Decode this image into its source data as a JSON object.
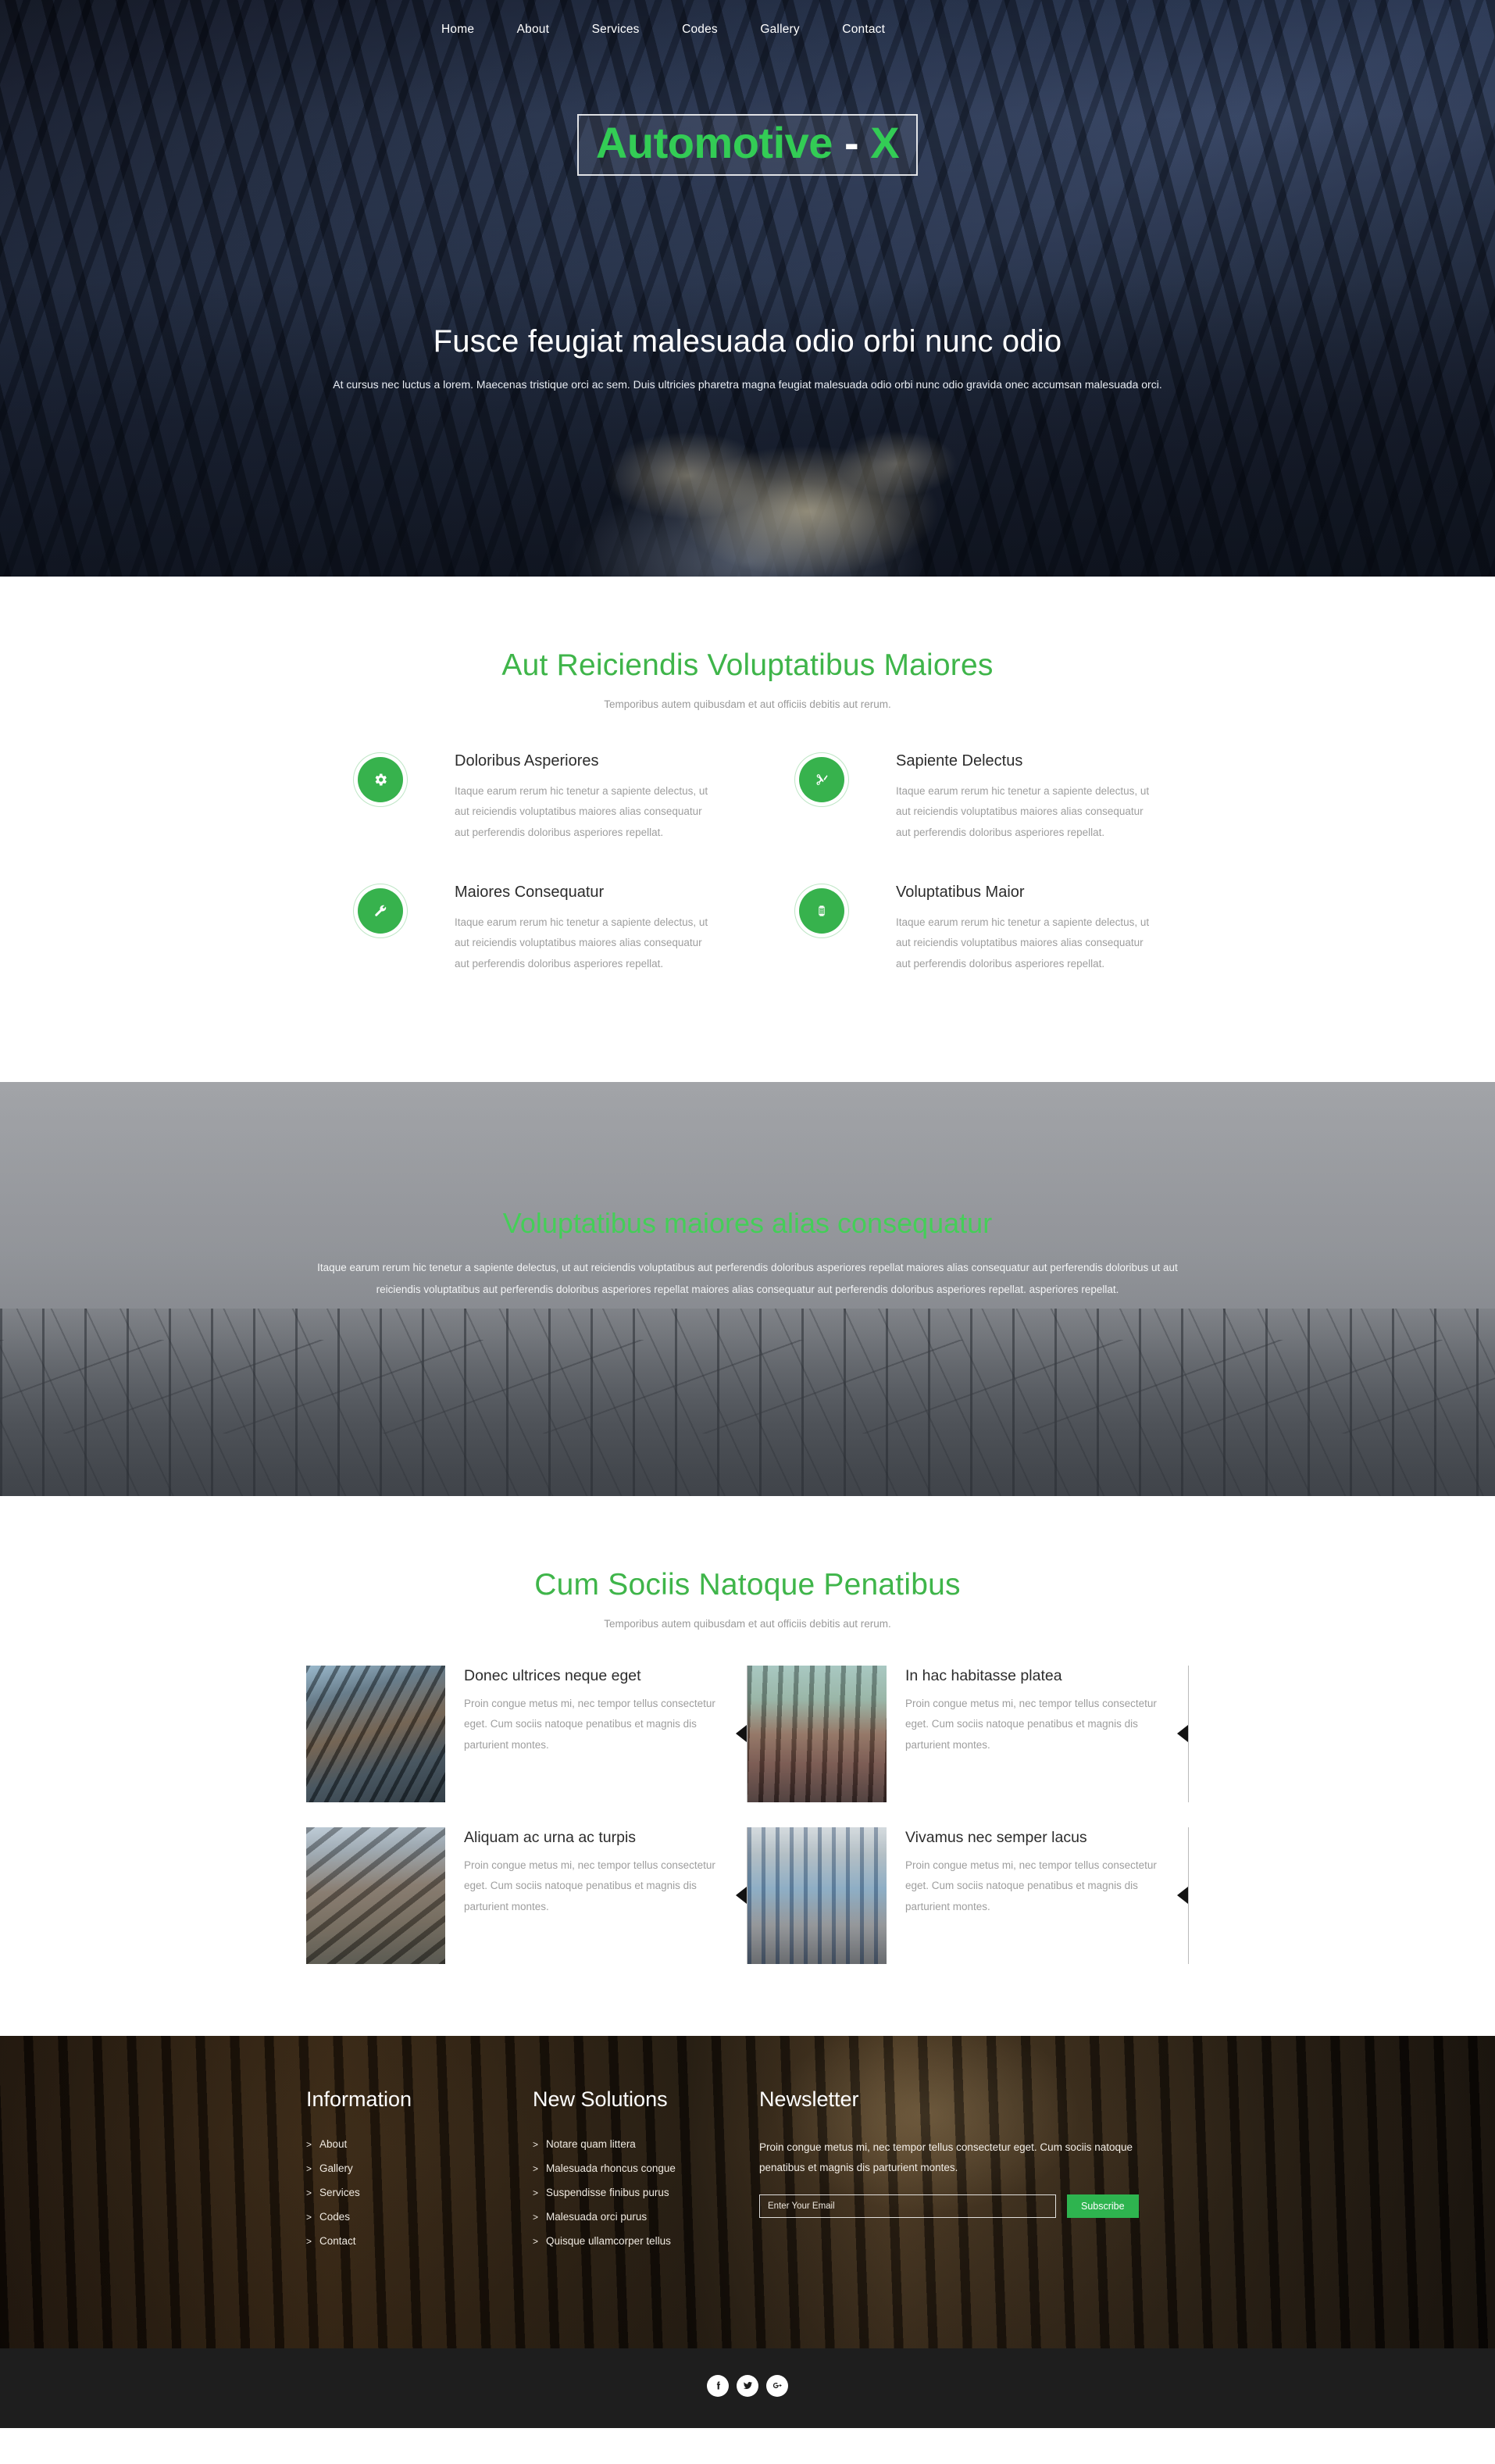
{
  "nav": {
    "items": [
      {
        "label": "Home"
      },
      {
        "label": "About"
      },
      {
        "label": "Services"
      },
      {
        "label": "Codes"
      },
      {
        "label": "Gallery"
      },
      {
        "label": "Contact"
      }
    ]
  },
  "hero": {
    "logo_main": "Automotive",
    "logo_dash": "-",
    "logo_suffix": "X",
    "title": "Fusce feugiat malesuada odio orbi nunc odio",
    "subtitle": "At cursus nec luctus a lorem. Maecenas tristique orci ac sem. Duis ultricies pharetra magna feugiat malesuada odio orbi nunc odio gravida onec accumsan malesuada orci."
  },
  "services": {
    "title": "Aut Reiciendis Voluptatibus Maiores",
    "subtitle": "Temporibus autem quibusdam et aut officiis debitis aut rerum.",
    "items": [
      {
        "icon": "gear-icon",
        "title": "Doloribus Asperiores",
        "text": "Itaque earum rerum hic tenetur a sapiente delectus, ut aut reiciendis voluptatibus maiores alias consequatur aut perferendis doloribus asperiores repellat."
      },
      {
        "icon": "scissors-icon",
        "title": "Sapiente Delectus",
        "text": "Itaque earum rerum hic tenetur a sapiente delectus, ut aut reiciendis voluptatibus maiores alias consequatur aut perferendis doloribus asperiores repellat."
      },
      {
        "icon": "wrench-icon",
        "title": "Maiores Consequatur",
        "text": "Itaque earum rerum hic tenetur a sapiente delectus, ut aut reiciendis voluptatibus maiores alias consequatur aut perferendis doloribus asperiores repellat."
      },
      {
        "icon": "battery-icon",
        "title": "Voluptatibus Maior",
        "text": "Itaque earum rerum hic tenetur a sapiente delectus, ut aut reiciendis voluptatibus maiores alias consequatur aut perferendis doloribus asperiores repellat."
      }
    ]
  },
  "parallax": {
    "title": "Voluptatibus maiores alias consequatur",
    "text": "Itaque earum rerum hic tenetur a sapiente delectus, ut aut reiciendis voluptatibus aut perferendis doloribus asperiores repellat maiores alias consequatur aut perferendis doloribus ut aut reiciendis voluptatibus aut perferendis doloribus asperiores repellat maiores alias consequatur aut perferendis doloribus asperiores repellat. asperiores repellat."
  },
  "gallery": {
    "title": "Cum Sociis Natoque Penatibus",
    "subtitle": "Temporibus autem quibusdam et aut officiis debitis aut rerum.",
    "cards": [
      {
        "title": "Donec ultrices neque eget",
        "text": "Proin congue metus mi, nec tempor tellus consectetur eget. Cum sociis natoque penatibus et magnis dis parturient montes.",
        "thumb": "industrial-pipes-reflection-photo"
      },
      {
        "title": "In hac habitasse platea",
        "text": "Proin congue metus mi, nec tempor tellus consectetur eget. Cum sociis natoque penatibus et magnis dis parturient montes.",
        "thumb": "harbor-crane-containers-photo"
      },
      {
        "title": "Aliquam ac urna ac turpis",
        "text": "Proin congue metus mi, nec tempor tellus consectetur eget. Cum sociis natoque penatibus et magnis dis parturient montes.",
        "thumb": "refinery-pipeline-photo"
      },
      {
        "title": "Vivamus nec semper lacus",
        "text": "Proin congue metus mi, nec tempor tellus consectetur eget. Cum sociis natoque penatibus et magnis dis parturient montes.",
        "thumb": "factory-machinery-photo"
      }
    ]
  },
  "footer": {
    "information": {
      "title": "Information",
      "links": [
        {
          "label": "About"
        },
        {
          "label": "Gallery"
        },
        {
          "label": "Services"
        },
        {
          "label": "Codes"
        },
        {
          "label": "Contact"
        }
      ]
    },
    "solutions": {
      "title": "New Solutions",
      "links": [
        {
          "label": "Notare quam littera"
        },
        {
          "label": "Malesuada rhoncus congue"
        },
        {
          "label": "Suspendisse finibus purus"
        },
        {
          "label": "Malesuada orci purus"
        },
        {
          "label": "Quisque ullamcorper tellus"
        }
      ]
    },
    "newsletter": {
      "title": "Newsletter",
      "text": "Proin congue metus mi, nec tempor tellus consectetur eget. Cum sociis natoque penatibus et magnis dis parturient montes.",
      "placeholder": "Enter Your Email",
      "input_value": "",
      "button_label": "Subscribe"
    },
    "list_bullet": ">"
  },
  "bottombar": {
    "social": [
      {
        "name": "facebook-icon"
      },
      {
        "name": "twitter-icon"
      },
      {
        "name": "google-plus-icon"
      }
    ]
  },
  "colors": {
    "brand_green": "#3fb54a",
    "logo_green": "#33cc55",
    "button_green": "#2eb44f",
    "footer_dark": "#1e1e1e"
  }
}
